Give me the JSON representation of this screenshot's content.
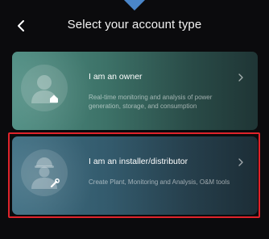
{
  "header": {
    "title": "Select your account type"
  },
  "cards": [
    {
      "title": "I am an owner",
      "description": "Real-time monitoring and analysis of power generation, storage, and consumption",
      "selected": false
    },
    {
      "title": "I am an installer/distributor",
      "description": "Create Plant, Monitoring and Analysis, O&M tools",
      "selected": true
    }
  ],
  "colors": {
    "background": "#0b0b0d",
    "owner_card": "#4e8d82",
    "installer_card": "#3f6f83",
    "selection_outline": "#e0232b",
    "top_indicator": "#4a86c9"
  },
  "icons": {
    "back": "chevron-left-icon",
    "owner": "person-home-icon",
    "installer": "worker-helmet-icon",
    "forward": "chevron-right-icon"
  }
}
